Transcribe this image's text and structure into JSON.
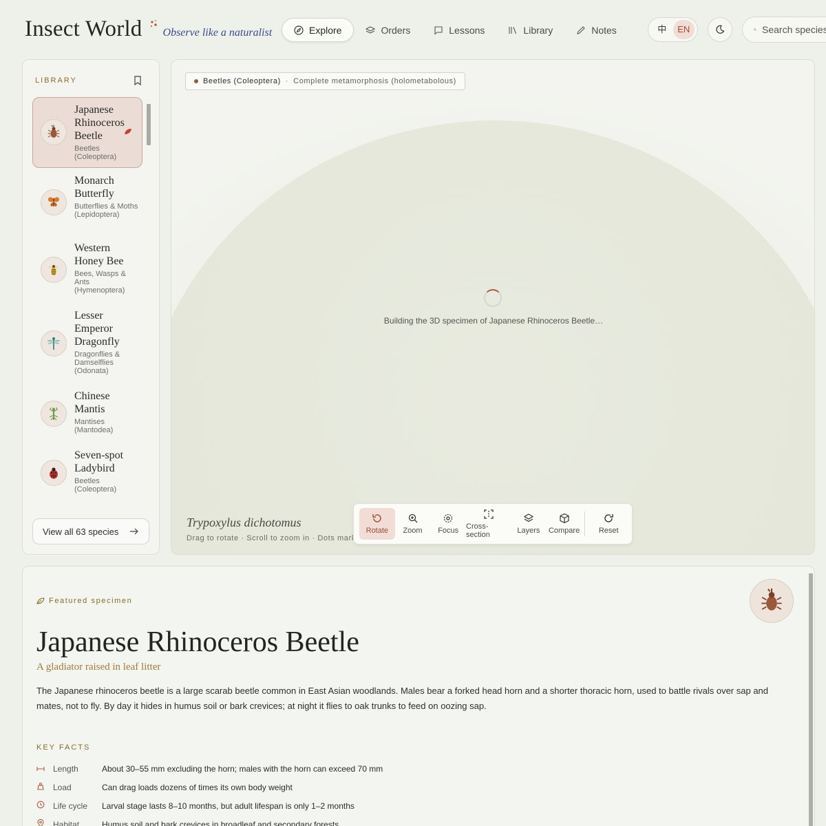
{
  "brand": {
    "title": "Insect World",
    "tagline": "Observe like a naturalist"
  },
  "nav": [
    {
      "label": "Explore",
      "icon": "compass-icon",
      "active": true
    },
    {
      "label": "Orders",
      "icon": "layers-icon"
    },
    {
      "label": "Lessons",
      "icon": "chat-icon"
    },
    {
      "label": "Library",
      "icon": "books-icon"
    },
    {
      "label": "Notes",
      "icon": "pencil-icon"
    }
  ],
  "lang": {
    "zh": "中",
    "en": "EN",
    "selected": "EN"
  },
  "search": {
    "placeholder": "Search species"
  },
  "sidebar": {
    "heading": "LIBRARY",
    "items": [
      {
        "name": "Japanese Rhinoceros Beetle",
        "group": "Beetles (Coleoptera)",
        "icon": "beetle-icon",
        "active": true
      },
      {
        "name": "Monarch Butterfly",
        "group": "Butterflies & Moths (Lepidoptera)",
        "icon": "butterfly-icon"
      },
      {
        "name": "Western Honey Bee",
        "group": "Bees, Wasps & Ants (Hymenoptera)",
        "icon": "bee-icon"
      },
      {
        "name": "Lesser Emperor Dragonfly",
        "group": "Dragonflies & Damselflies (Odonata)",
        "icon": "dragonfly-icon"
      },
      {
        "name": "Chinese Mantis",
        "group": "Mantises (Mantodea)",
        "icon": "mantis-icon"
      },
      {
        "name": "Seven-spot Ladybird",
        "group": "Beetles (Coleoptera)",
        "icon": "ladybird-icon"
      }
    ],
    "view_all": "View all 63 species"
  },
  "viewer": {
    "order": "Beetles (Coleoptera)",
    "metamorphosis": "Complete metamorphosis (holometabolous)",
    "loading": "Building the 3D specimen of Japanese Rhinoceros Beetle…",
    "scientific_name": "Trypoxylus dichotomus",
    "hint": "Drag to rotate · Scroll to zoom in · Dots mark",
    "tools": [
      {
        "label": "Rotate",
        "icon": "rotate-icon",
        "active": true
      },
      {
        "label": "Zoom",
        "icon": "zoom-icon"
      },
      {
        "label": "Focus",
        "icon": "focus-icon"
      },
      {
        "label": "Cross-section",
        "icon": "cross-section-icon"
      },
      {
        "label": "Layers",
        "icon": "layers-icon"
      },
      {
        "label": "Compare",
        "icon": "cube-icon"
      },
      {
        "label": "Reset",
        "icon": "reset-icon"
      }
    ]
  },
  "featured": {
    "label": "Featured specimen",
    "title": "Japanese Rhinoceros Beetle",
    "subtitle": "A gladiator raised in leaf litter",
    "body": "The Japanese rhinoceros beetle is a large scarab beetle common in East Asian woodlands. Males bear a forked head horn and a shorter thoracic horn, used to battle rivals over sap and mates, not to fly. By day it hides in humus soil or bark crevices; at night it flies to oak trunks to feed on oozing sap.",
    "key_facts_heading": "KEY FACTS",
    "facts": [
      {
        "key": "Length",
        "value": "About 30–55 mm excluding the horn; males with the horn can exceed 70 mm",
        "icon": "ruler-icon"
      },
      {
        "key": "Load",
        "value": "Can drag loads dozens of times its own body weight",
        "icon": "weight-icon"
      },
      {
        "key": "Life cycle",
        "value": "Larval stage lasts 8–10 months, but adult lifespan is only 1–2 months",
        "icon": "clock-icon"
      },
      {
        "key": "Habitat",
        "value": "Humus soil and bark crevices in broadleaf and secondary forests",
        "icon": "pin-icon"
      }
    ]
  },
  "colors": {
    "accent": "#a14a38",
    "gold": "#8a6a2e",
    "link": "#3c4a8a"
  }
}
